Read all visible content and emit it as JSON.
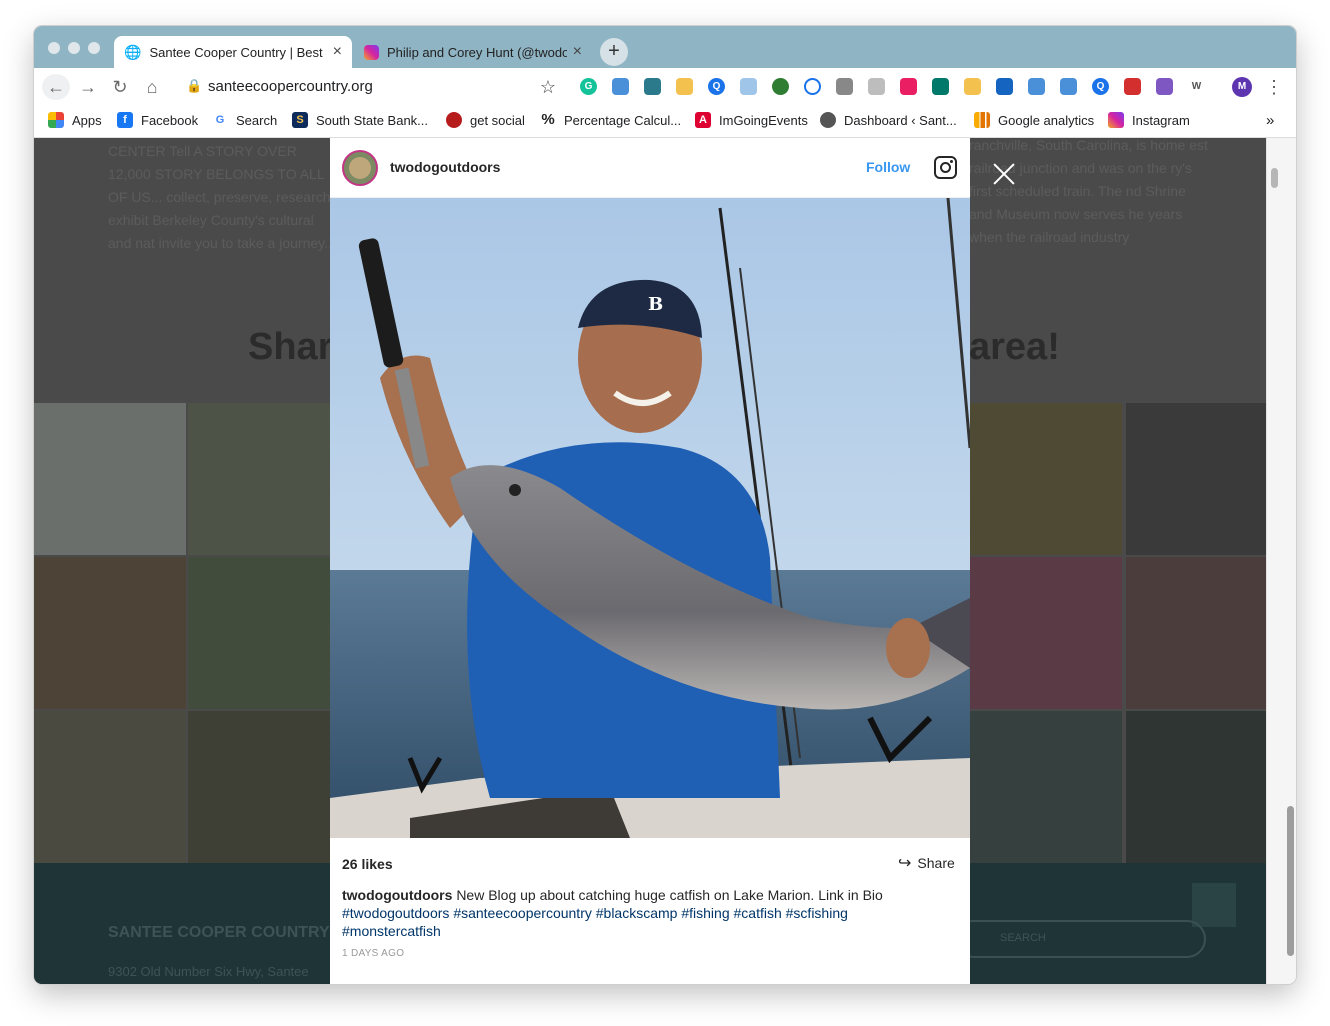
{
  "browser": {
    "tabs": [
      {
        "title": "Santee Cooper Country | Best",
        "active": true
      },
      {
        "title": "Philip and Corey Hunt (@twodo",
        "active": false
      }
    ],
    "new_tab_label": "+",
    "url": "santeecoopercountry.org",
    "profile_initial": "M",
    "bookmarks": [
      {
        "label": "Apps",
        "icon": "apps-grid-icon"
      },
      {
        "label": "Facebook",
        "icon": "facebook-icon"
      },
      {
        "label": "Search",
        "icon": "google-icon"
      },
      {
        "label": "South State Bank...",
        "icon": "bank-icon"
      },
      {
        "label": "get social",
        "icon": "mustache-icon"
      },
      {
        "label": "Percentage Calcul...",
        "icon": "percent-icon"
      },
      {
        "label": "ImGoingEvents",
        "icon": "angular-icon"
      },
      {
        "label": "Dashboard ‹ Sant...",
        "icon": "globe-icon"
      },
      {
        "label": "Google analytics",
        "icon": "analytics-icon"
      },
      {
        "label": "Instagram",
        "icon": "instagram-icon"
      }
    ],
    "more_bookmarks": "»"
  },
  "page": {
    "left_text": "CENTER Tell A STORY OVER 12,000 STORY BELONGS TO ALL OF US... collect, preserve, research, exhibit Berkeley County's cultural and nat invite you to take a journey...",
    "right_text": "ranchville, South Carolina, is home est railroad junction and was on the ry's first scheduled train. The nd Shrine and Museum now serves he years when the railroad industry",
    "heading_left": "Shar",
    "heading_right": "area!",
    "footer_title": "SANTEE COOPER COUNTRY",
    "footer_address": "9302 Old Number Six Hwy, Santee",
    "footer_search": "SEARCH"
  },
  "modal": {
    "username": "twodogoutdoors",
    "follow_label": "Follow",
    "likes": "26 likes",
    "share_label": "Share",
    "caption_text": "New Blog up about catching huge catfish on Lake Marion. Link in Bio",
    "hashtags": [
      "#twodogoutdoors",
      "#santeecoopercountry",
      "#blackscamp",
      "#fishing",
      "#catfish",
      "#scfishing",
      "#monstercatfish"
    ],
    "date": "1 DAYS AGO"
  },
  "colors": {
    "tab_strip": "#8fb4c4",
    "follow_blue": "#3897f0",
    "hashtag_blue": "#003569",
    "footer_bg": "#1f3436"
  }
}
